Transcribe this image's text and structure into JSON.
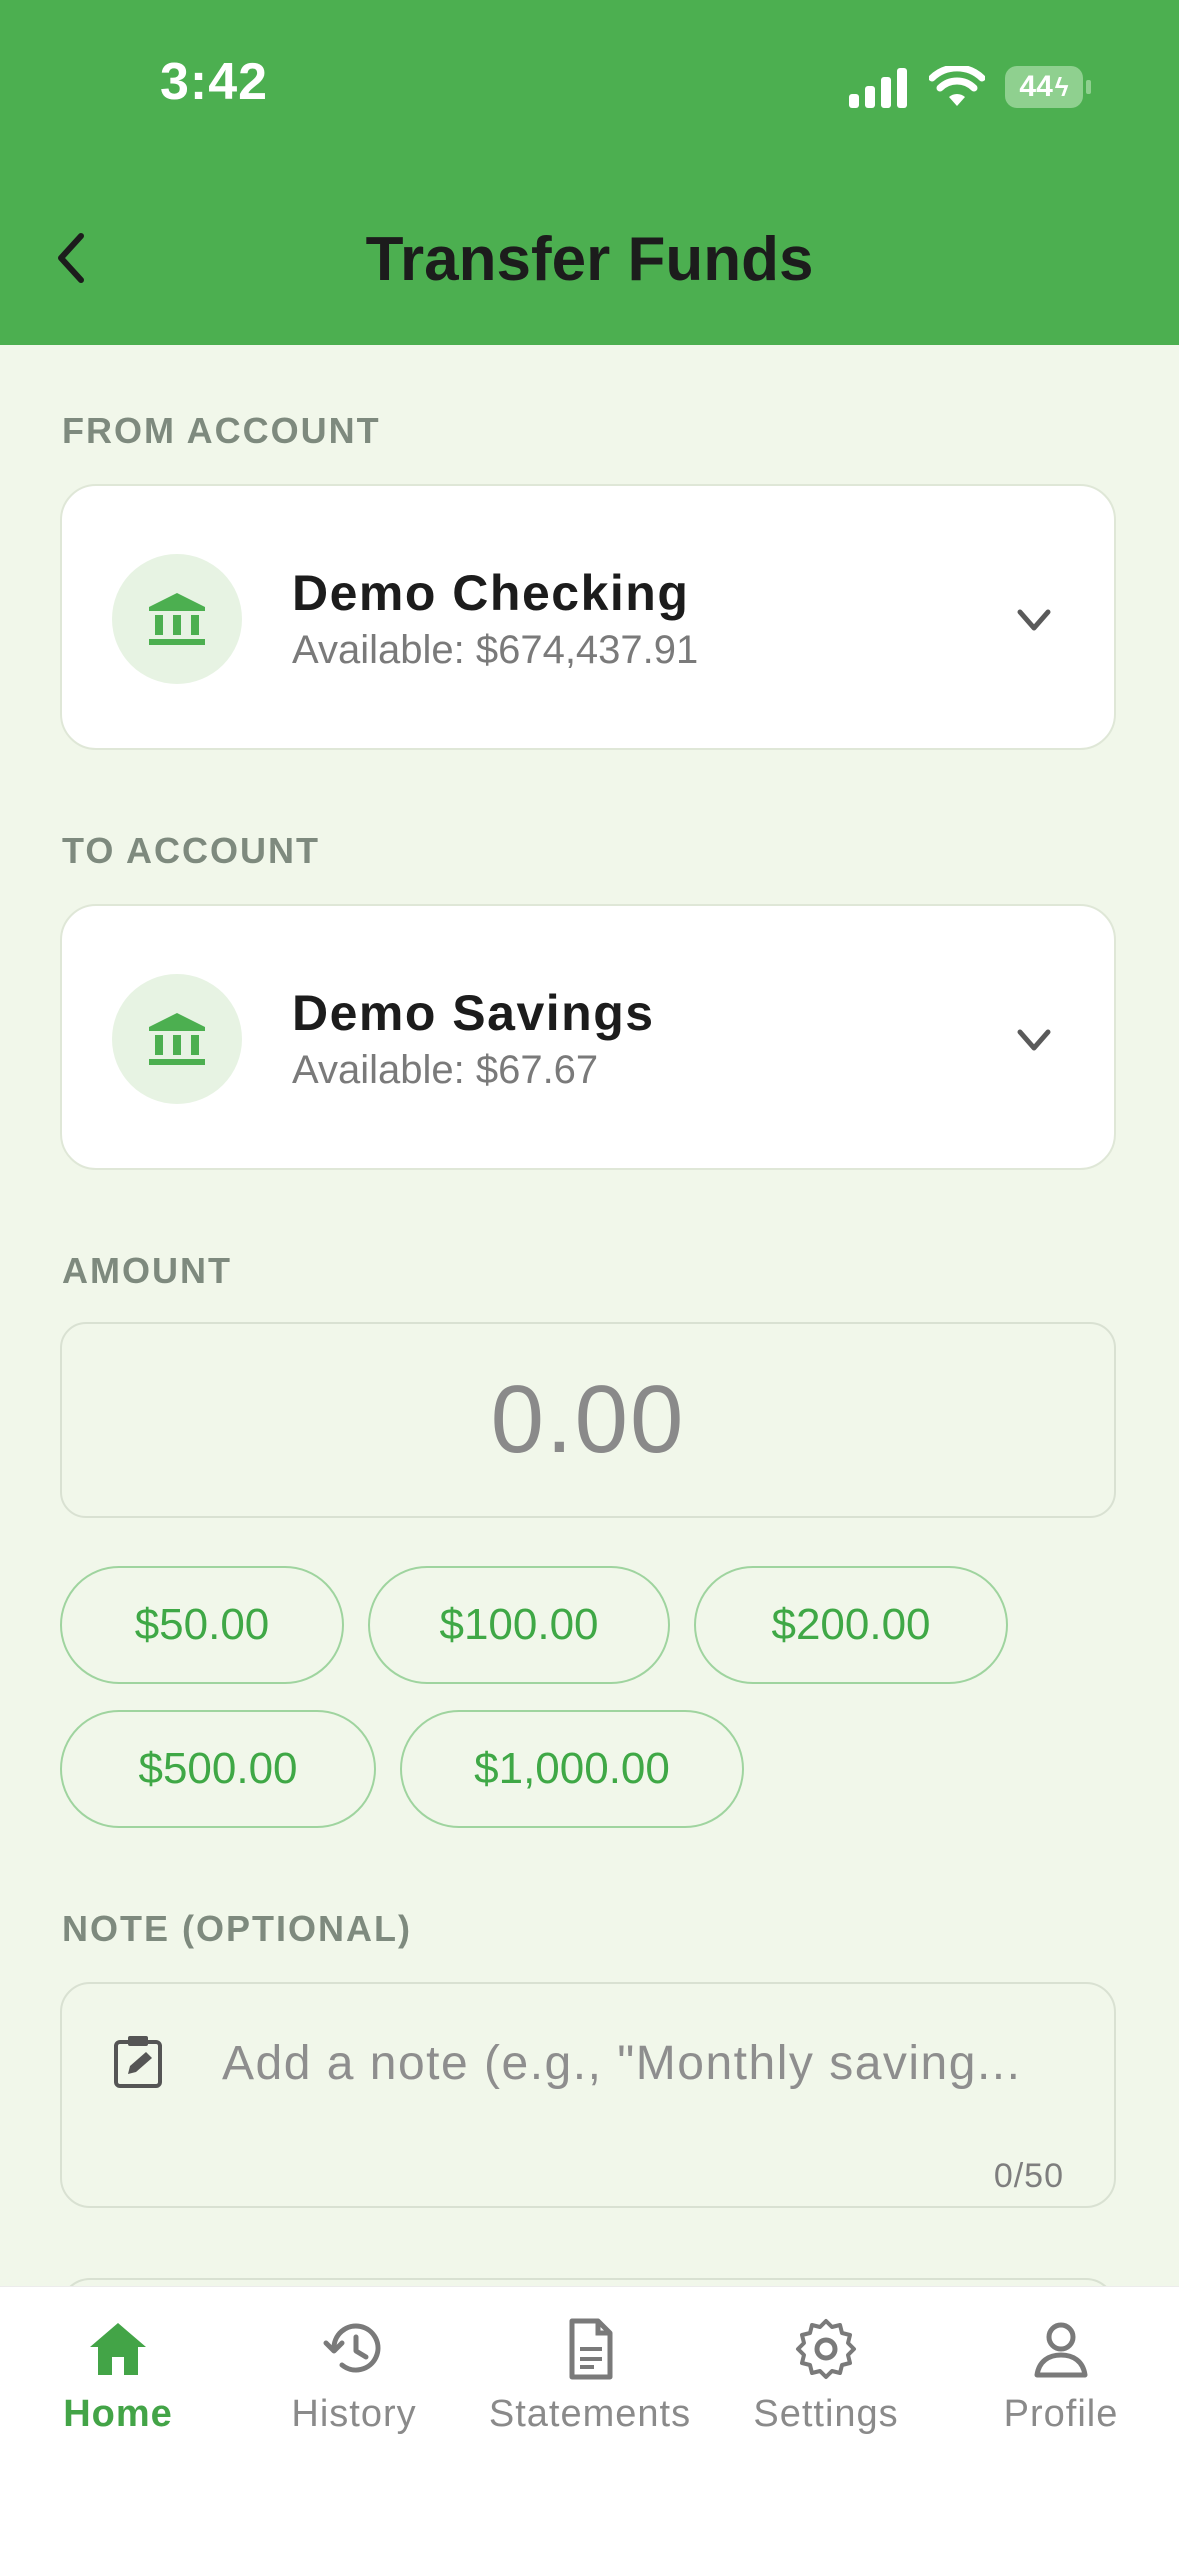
{
  "status_bar": {
    "time": "3:42",
    "battery": "44"
  },
  "header": {
    "title": "Transfer Funds"
  },
  "from_account": {
    "label": "FROM ACCOUNT",
    "name": "Demo Checking",
    "available": "Available: $674,437.91"
  },
  "to_account": {
    "label": "TO ACCOUNT",
    "name": "Demo Savings",
    "available": "Available: $67.67"
  },
  "amount": {
    "label": "AMOUNT",
    "value": "0.00",
    "quick_amounts": [
      "$50.00",
      "$100.00",
      "$200.00",
      "$500.00",
      "$1,000.00"
    ]
  },
  "note": {
    "label": "NOTE (OPTIONAL)",
    "placeholder": "Add a note (e.g., \"Monthly saving...",
    "counter": "0/50"
  },
  "bottom_nav": {
    "items": [
      {
        "label": "Home",
        "icon": "home-icon",
        "active": true
      },
      {
        "label": "History",
        "icon": "history-icon",
        "active": false
      },
      {
        "label": "Statements",
        "icon": "document-icon",
        "active": false
      },
      {
        "label": "Settings",
        "icon": "gear-icon",
        "active": false
      },
      {
        "label": "Profile",
        "icon": "person-icon",
        "active": false
      }
    ]
  },
  "colors": {
    "primary": "#4caf50",
    "accent_text": "#3fa846",
    "background": "#f1f7ea"
  }
}
